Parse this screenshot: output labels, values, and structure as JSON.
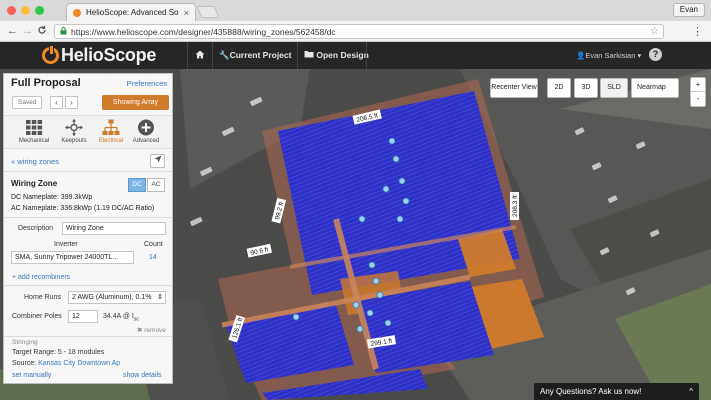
{
  "browser": {
    "tab_title": "HelioScope: Advanced Solar D",
    "tab_close": "×",
    "profile": "Evan",
    "url": "https://www.helioscope.com/designer/435888/wiring_zones/562458/dc",
    "lock": "🔒",
    "back": "←",
    "forward": "→",
    "reload": "C",
    "star": "☆",
    "menu": "⋮"
  },
  "header": {
    "logo_text": "HelioScope",
    "home_icon": "home-icon",
    "current_project": "Current Project",
    "open_design": "Open Design",
    "user": "Evan Sarkisian",
    "help": "?"
  },
  "map_controls": {
    "recenter": "Recenter View",
    "view_2d": "2D",
    "view_3d": "3D",
    "sld": "SLD",
    "basemap": "Nearmap",
    "zoom_in": "+",
    "zoom_out": "-"
  },
  "map_labels": {
    "dim_top": "206.5 ft",
    "dim_right": "208.3 ft",
    "dim_left_upper": "99.2 ft",
    "dim_mid": "90.6 ft",
    "dim_left_lower": "126.1 ft",
    "dim_bottom": "299.1 ft"
  },
  "sidebar": {
    "title": "Full Proposal",
    "preferences": "Preferences",
    "saved": "Saved",
    "prev": "‹",
    "next": "›",
    "showing_array": "Showing Array",
    "modes": [
      {
        "label": "Mechanical",
        "icon": "grid-icon"
      },
      {
        "label": "Keepouts",
        "icon": "keepout-icon"
      },
      {
        "label": "Electrical",
        "icon": "electrical-icon"
      },
      {
        "label": "Advanced",
        "icon": "plus-icon"
      }
    ],
    "back_link": "« wiring zones",
    "wiring_zone_title": "Wiring Zone",
    "dc": "DC",
    "ac": "AC",
    "dc_nameplate": "DC Nameplate: 399.3kWp",
    "ac_nameplate": "AC Nameplate: 336.8kWp (1.19 DC/AC Ratio)",
    "description_label": "Description",
    "description_value": "Wiring Zone",
    "inverter_label": "Inverter",
    "count_label": "Count",
    "inverter_value": "SMA, Sunny Tripower 24000TL...",
    "inverter_count": "14",
    "add_recombiners": "+ add recombiners",
    "home_runs_label": "Home Runs",
    "home_runs_value": "2 AWG (Aluminum), 0.1%",
    "combiner_poles_label": "Combiner Poles",
    "combiner_poles_value": "12",
    "combiner_amps": "34.4A @ I",
    "combiner_amps_sub": "sc",
    "remove": "✖ remove",
    "stringing_label": "Stringing",
    "target_range": "Target Range: 5 - 18 modules",
    "source_label": "Source:",
    "source_value": "Kansas City Downtown Ap",
    "set_manually": "set manually",
    "show_details": "show details"
  },
  "chat": {
    "label": "Any Questions? Ask us now!",
    "caret": "^"
  }
}
